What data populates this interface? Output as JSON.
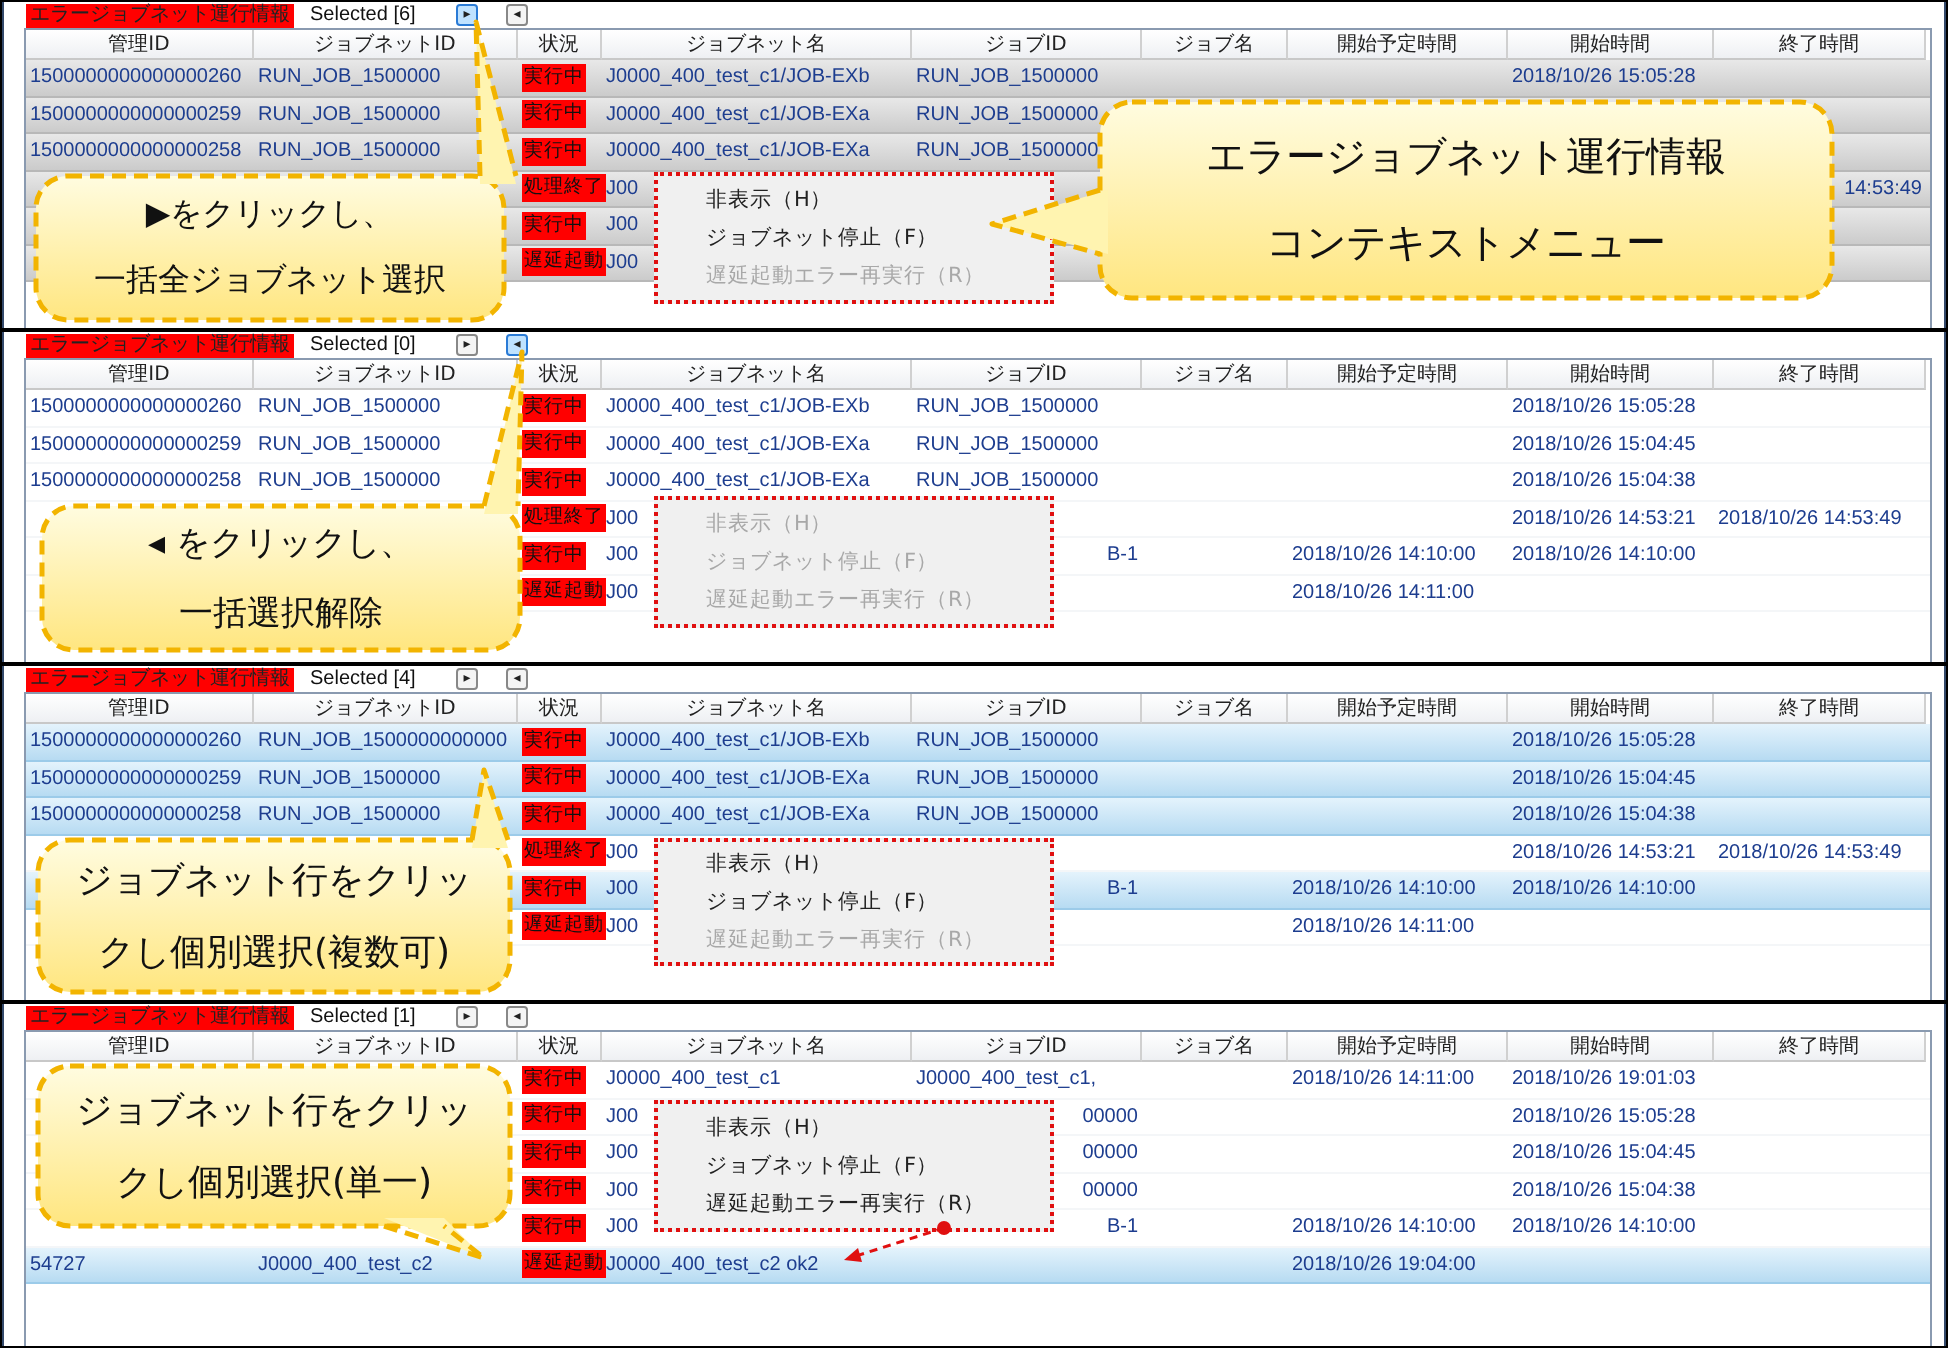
{
  "panels": [
    {
      "title": "エラージョブネット運行情報",
      "selected_count": "Selected [6]",
      "toggle_buttons": [
        {
          "label": "▸",
          "highlighted": true
        },
        {
          "label": "◂",
          "highlighted": false
        }
      ],
      "columns": [
        "管理ID",
        "ジョブネットID",
        "状況",
        "ジョブネット名",
        "ジョブID",
        "ジョブ名",
        "開始予定時間",
        "開始時間",
        "終了時間"
      ],
      "selection_focus": false,
      "rows": [
        {
          "selected": true,
          "cells": [
            "1500000000000000260",
            "RUN_JOB_1500000",
            "実行中",
            "J0000_400_test_c1/JOB-EXb",
            "RUN_JOB_1500000",
            null,
            null,
            "2018/10/26 15:05:28",
            null
          ]
        },
        {
          "selected": true,
          "cells": [
            "1500000000000000259",
            "RUN_JOB_1500000",
            "実行中",
            "J0000_400_test_c1/JOB-EXa",
            "RUN_JOB_1500000",
            null,
            null,
            null,
            null
          ]
        },
        {
          "selected": true,
          "cells": [
            "1500000000000000258",
            "RUN_JOB_1500000",
            "実行中",
            "J0000_400_test_c1/JOB-EXa",
            "RUN_JOB_1500000",
            null,
            null,
            null,
            null
          ]
        },
        {
          "selected": true,
          "cells": [
            null,
            null,
            "処理終了",
            "J00",
            null,
            null,
            null,
            null,
            {
              "text": "14:53:49",
              "tail": true
            }
          ]
        },
        {
          "selected": true,
          "cells": [
            null,
            null,
            "実行中",
            "J00",
            null,
            null,
            null,
            null,
            null
          ]
        },
        {
          "selected": true,
          "cells": [
            null,
            null,
            "遅延起動",
            "J00",
            null,
            null,
            null,
            null,
            null
          ]
        }
      ],
      "context_menu": {
        "items": [
          {
            "label": "非表示（H）",
            "disabled": false
          },
          {
            "label": "ジョブネット停止（F）",
            "disabled": false
          },
          {
            "label": "遅延起動エラー再実行（R）",
            "disabled": true
          }
        ]
      },
      "callouts": [
        {
          "lines": [
            "▶をクリックし、",
            "一括全ジョブネット選択"
          ]
        },
        {
          "lines": [
            "エラージョブネット運行情報",
            "コンテキストメニュー"
          ]
        }
      ]
    },
    {
      "title": "エラージョブネット運行情報",
      "selected_count": "Selected [0]",
      "toggle_buttons": [
        {
          "label": "▸",
          "highlighted": false
        },
        {
          "label": "◂",
          "highlighted": true
        }
      ],
      "columns": [
        "管理ID",
        "ジョブネットID",
        "状況",
        "ジョブネット名",
        "ジョブID",
        "ジョブ名",
        "開始予定時間",
        "開始時間",
        "終了時間"
      ],
      "rows": [
        {
          "selected": false,
          "cells": [
            "1500000000000000260",
            "RUN_JOB_1500000",
            "実行中",
            "J0000_400_test_c1/JOB-EXb",
            "RUN_JOB_1500000",
            null,
            null,
            "2018/10/26 15:05:28",
            null
          ]
        },
        {
          "selected": false,
          "cells": [
            "1500000000000000259",
            "RUN_JOB_1500000",
            "実行中",
            "J0000_400_test_c1/JOB-EXa",
            "RUN_JOB_1500000",
            null,
            null,
            "2018/10/26 15:04:45",
            null
          ]
        },
        {
          "selected": false,
          "cells": [
            "1500000000000000258",
            "RUN_JOB_1500000",
            "実行中",
            "J0000_400_test_c1/JOB-EXa",
            "RUN_JOB_1500000",
            null,
            null,
            "2018/10/26 15:04:38",
            null
          ]
        },
        {
          "selected": false,
          "cells": [
            null,
            null,
            "処理終了",
            "J00",
            null,
            null,
            null,
            "2018/10/26 14:53:21",
            "2018/10/26 14:53:49"
          ]
        },
        {
          "selected": false,
          "cells": [
            null,
            null,
            "実行中",
            "J00",
            {
              "text": "B-1",
              "tail": true
            },
            null,
            "2018/10/26 14:10:00",
            "2018/10/26 14:10:00",
            null
          ]
        },
        {
          "selected": false,
          "cells": [
            null,
            null,
            "遅延起動",
            "J00",
            null,
            null,
            "2018/10/26 14:11:00",
            null,
            null
          ]
        }
      ],
      "context_menu": {
        "items": [
          {
            "label": "非表示（H）",
            "disabled": true
          },
          {
            "label": "ジョブネット停止（F）",
            "disabled": true
          },
          {
            "label": "遅延起動エラー再実行（R）",
            "disabled": true
          }
        ]
      },
      "callouts": [
        {
          "lines": [
            "◂ をクリックし、",
            "一括選択解除"
          ]
        }
      ]
    },
    {
      "title": "エラージョブネット運行情報",
      "selected_count": "Selected [4]",
      "toggle_buttons": [
        {
          "label": "▸",
          "highlighted": false
        },
        {
          "label": "◂",
          "highlighted": false
        }
      ],
      "columns": [
        "管理ID",
        "ジョブネットID",
        "状況",
        "ジョブネット名",
        "ジョブID",
        "ジョブ名",
        "開始予定時間",
        "開始時間",
        "終了時間"
      ],
      "selection_focus": true,
      "rows": [
        {
          "selected": true,
          "cells": [
            "1500000000000000260",
            "RUN_JOB_1500000000000",
            "実行中",
            "J0000_400_test_c1/JOB-EXb",
            "RUN_JOB_1500000",
            null,
            null,
            "2018/10/26 15:05:28",
            null
          ]
        },
        {
          "selected": true,
          "cells": [
            "1500000000000000259",
            "RUN_JOB_1500000",
            "実行中",
            "J0000_400_test_c1/JOB-EXa",
            "RUN_JOB_1500000",
            null,
            null,
            "2018/10/26 15:04:45",
            null
          ]
        },
        {
          "selected": true,
          "cells": [
            "1500000000000000258",
            "RUN_JOB_1500000",
            "実行中",
            "J0000_400_test_c1/JOB-EXa",
            "RUN_JOB_1500000",
            null,
            null,
            "2018/10/26 15:04:38",
            null
          ]
        },
        {
          "selected": false,
          "cells": [
            null,
            null,
            "処理終了",
            "J00",
            null,
            null,
            null,
            "2018/10/26 14:53:21",
            "2018/10/26 14:53:49"
          ]
        },
        {
          "selected": true,
          "cells": [
            null,
            null,
            "実行中",
            "J00",
            {
              "text": "B-1",
              "tail": true
            },
            null,
            "2018/10/26 14:10:00",
            "2018/10/26 14:10:00",
            null
          ]
        },
        {
          "selected": false,
          "cells": [
            null,
            null,
            "遅延起動",
            "J00",
            null,
            null,
            "2018/10/26 14:11:00",
            null,
            null
          ]
        }
      ],
      "context_menu": {
        "items": [
          {
            "label": "非表示（H）",
            "disabled": false
          },
          {
            "label": "ジョブネット停止（F）",
            "disabled": false
          },
          {
            "label": "遅延起動エラー再実行（R）",
            "disabled": true
          }
        ]
      },
      "callouts": [
        {
          "lines": [
            "ジョブネット行をクリッ",
            "クし個別選択(複数可)"
          ]
        }
      ]
    },
    {
      "title": "エラージョブネット運行情報",
      "selected_count": "Selected [1]",
      "toggle_buttons": [
        {
          "label": "▸",
          "highlighted": false
        },
        {
          "label": "◂",
          "highlighted": false
        }
      ],
      "columns": [
        "管理ID",
        "ジョブネットID",
        "状況",
        "ジョブネット名",
        "ジョブID",
        "ジョブ名",
        "開始予定時間",
        "開始時間",
        "終了時間"
      ],
      "selection_focus": true,
      "rows": [
        {
          "selected": false,
          "cells": [
            null,
            null,
            "実行中",
            "J0000_400_test_c1",
            "J0000_400_test_c1,",
            null,
            "2018/10/26 14:11:00",
            "2018/10/26 19:01:03",
            null
          ]
        },
        {
          "selected": false,
          "cells": [
            null,
            null,
            "実行中",
            "J00",
            {
              "text": "00000",
              "tail": true
            },
            null,
            null,
            "2018/10/26 15:05:28",
            null
          ]
        },
        {
          "selected": false,
          "cells": [
            null,
            null,
            "実行中",
            "J00",
            {
              "text": "00000",
              "tail": true
            },
            null,
            null,
            "2018/10/26 15:04:45",
            null
          ]
        },
        {
          "selected": false,
          "cells": [
            null,
            null,
            "実行中",
            "J00",
            {
              "text": "00000",
              "tail": true
            },
            null,
            null,
            "2018/10/26 15:04:38",
            null
          ]
        },
        {
          "selected": false,
          "cells": [
            null,
            null,
            "実行中",
            "J00",
            {
              "text": "B-1",
              "tail": true
            },
            null,
            "2018/10/26 14:10:00",
            "2018/10/26 14:10:00",
            null
          ]
        },
        {
          "selected": true,
          "cells": [
            "54727",
            "J0000_400_test_c2",
            "遅延起動",
            "J0000_400_test_c2 ok2",
            null,
            null,
            "2018/10/26 19:04:00",
            null,
            null
          ]
        }
      ],
      "context_menu": {
        "items": [
          {
            "label": "非表示（H）",
            "disabled": false
          },
          {
            "label": "ジョブネット停止（F）",
            "disabled": false
          },
          {
            "label": "遅延起動エラー再実行（R）",
            "disabled": false
          }
        ]
      },
      "callouts": [
        {
          "lines": [
            "ジョブネット行をクリッ",
            "クし個別選択(単一)"
          ]
        }
      ]
    }
  ]
}
